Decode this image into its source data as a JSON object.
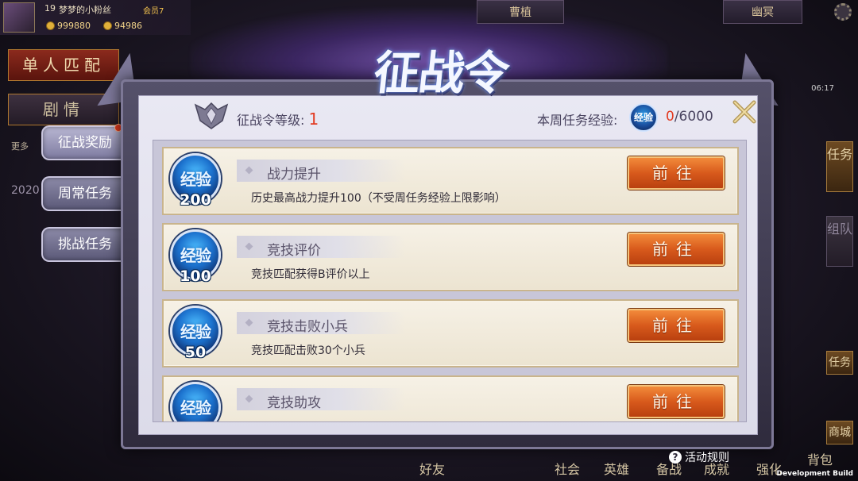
{
  "hud": {
    "level": "19",
    "player_name": "梦梦的小粉丝",
    "vip": "会员7",
    "coin_1": "999880",
    "coin_2": "94986",
    "top_tab_1": "曹植",
    "top_tab_2": "幽冥",
    "time": "06:17",
    "bg_button_1": "单人匹配",
    "bg_button_2": "剧情",
    "more": "更多",
    "year": "2020",
    "right_btn_1": "任务",
    "right_btn_2": "组队",
    "bottom_labels": [
      "好友",
      "社会",
      "英雄",
      "备战",
      "成就",
      "强化",
      "背包"
    ],
    "right_side_labels": [
      "任务",
      "商城"
    ]
  },
  "side_tabs": [
    {
      "label": "征战奖励",
      "has_red_dot": true
    },
    {
      "label": "周常任务",
      "has_red_dot": false
    },
    {
      "label": "挑战任务",
      "has_red_dot": false
    }
  ],
  "panel": {
    "title": "征战令",
    "rank_label": "征战令等级:",
    "rank_value": "1",
    "exp_label": "本周任务经验:",
    "exp_orb_text": "经验",
    "exp_current": "0",
    "exp_total": "/6000"
  },
  "tasks": [
    {
      "badge": "经验",
      "amount": "200",
      "title": "战力提升",
      "desc": "历史最高战力提升100（不受周任务经验上限影响）",
      "button": "前往"
    },
    {
      "badge": "经验",
      "amount": "100",
      "title": "竞技评价",
      "desc": "竞技匹配获得B评价以上",
      "button": "前往"
    },
    {
      "badge": "经验",
      "amount": "50",
      "title": "竞技击败小兵",
      "desc": "竞技匹配击败30个小兵",
      "button": "前往"
    },
    {
      "badge": "经验",
      "amount": "",
      "title": "竞技助攻",
      "desc": "",
      "button": "前往"
    }
  ],
  "footer": {
    "rules_label": "活动规则",
    "dev_build": "Development Build"
  },
  "colors": {
    "accent_red": "#e23b22",
    "button_orange": "#d85a1c",
    "panel_bg": "#e9e8f3"
  }
}
